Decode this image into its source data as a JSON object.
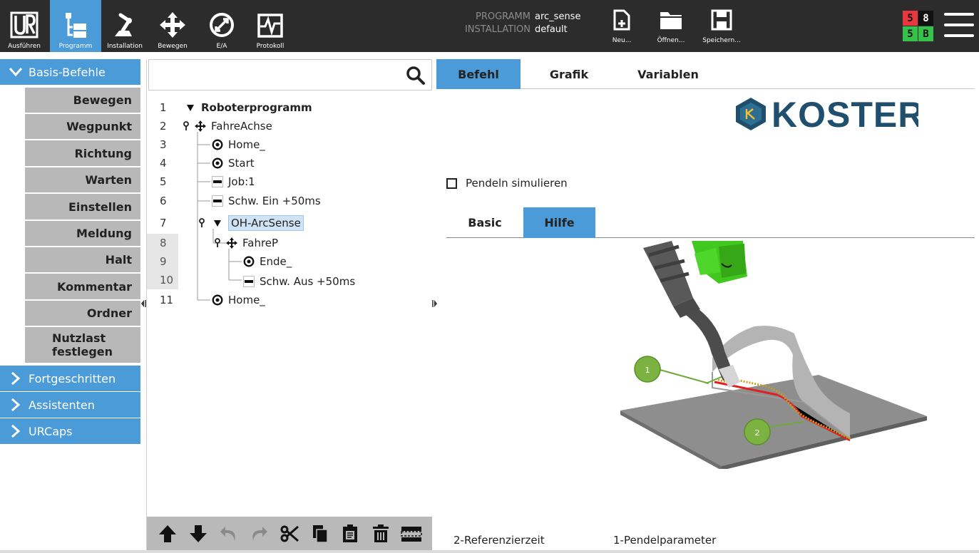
{
  "topbar": {
    "nav": [
      {
        "label": "Ausführen",
        "icon": "ur-logo-icon",
        "active": false
      },
      {
        "label": "Programm",
        "icon": "program-tree-icon",
        "active": true
      },
      {
        "label": "Installation",
        "icon": "installation-arm-icon",
        "active": false
      },
      {
        "label": "Bewegen",
        "icon": "move-arrows-icon",
        "active": false
      },
      {
        "label": "E/A",
        "icon": "io-icon",
        "active": false
      },
      {
        "label": "Protokoll",
        "icon": "log-icon",
        "active": false
      }
    ],
    "program_key": "PROGRAMM",
    "program_value": "arc_sense",
    "installation_key": "INSTALLATION",
    "installation_value": "default",
    "file_buttons": [
      {
        "label": "Neu...",
        "icon": "new-file-icon"
      },
      {
        "label": "Öffnen...",
        "icon": "open-folder-icon"
      },
      {
        "label": "Speichern...",
        "icon": "save-disk-icon"
      }
    ],
    "status": {
      "tl": "5",
      "tr": "8",
      "bl": "5",
      "br": "B"
    },
    "colors": {
      "bar": "#2c2c2c",
      "active": "#4a9bd8",
      "red": "#e8373e",
      "black": "#111111",
      "green": "#35c24a"
    }
  },
  "sidebar": {
    "basis": "Basis-Befehle",
    "commands": [
      "Bewegen",
      "Wegpunkt",
      "Richtung",
      "Warten",
      "Einstellen",
      "Meldung",
      "Halt",
      "Kommentar",
      "Ordner",
      "Nutzlast festlegen"
    ],
    "categories": [
      "Fortgeschritten",
      "Assistenten",
      "URCaps"
    ]
  },
  "tree": {
    "search_value": "",
    "lines": [
      {
        "n": "1",
        "label": "Roboterprogramm",
        "icon": "expand-triangle-icon"
      },
      {
        "n": "2",
        "label": "FahreAchse",
        "icon": "move-node-icon"
      },
      {
        "n": "3",
        "label": "Home_",
        "icon": "waypoint-icon"
      },
      {
        "n": "4",
        "label": "Start",
        "icon": "waypoint-icon"
      },
      {
        "n": "5",
        "label": "Job:1",
        "icon": "set-icon"
      },
      {
        "n": "6",
        "label": "Schw. Ein +50ms",
        "icon": "set-icon"
      },
      {
        "n": "7",
        "label": "OH-ArcSense",
        "icon": "expand-triangle-icon"
      },
      {
        "n": "8",
        "label": "FahreP",
        "icon": "move-node-icon"
      },
      {
        "n": "9",
        "label": "Ende_",
        "icon": "waypoint-icon"
      },
      {
        "n": "10",
        "label": "Schw. Aus +50ms",
        "icon": "set-icon"
      },
      {
        "n": "11",
        "label": "Home_",
        "icon": "waypoint-icon"
      }
    ],
    "toolbar": [
      "move-up-icon",
      "move-down-icon",
      "undo-icon",
      "redo-icon",
      "cut-icon",
      "copy-icon",
      "paste-icon",
      "delete-icon",
      "suppress-icon"
    ]
  },
  "content": {
    "tabs": [
      "Befehl",
      "Grafik",
      "Variablen"
    ],
    "active_tab": "Befehl",
    "logo_text": "KOSTER",
    "checkbox_label": "Pendeln simulieren",
    "checkbox_checked": false,
    "subtabs": [
      "Basic",
      "Hilfe"
    ],
    "active_subtab": "Hilfe",
    "marker_1": "1",
    "marker_2": "2",
    "footer_1": "2-Referenzierzeit",
    "footer_2": "1-Pendelparameter"
  }
}
